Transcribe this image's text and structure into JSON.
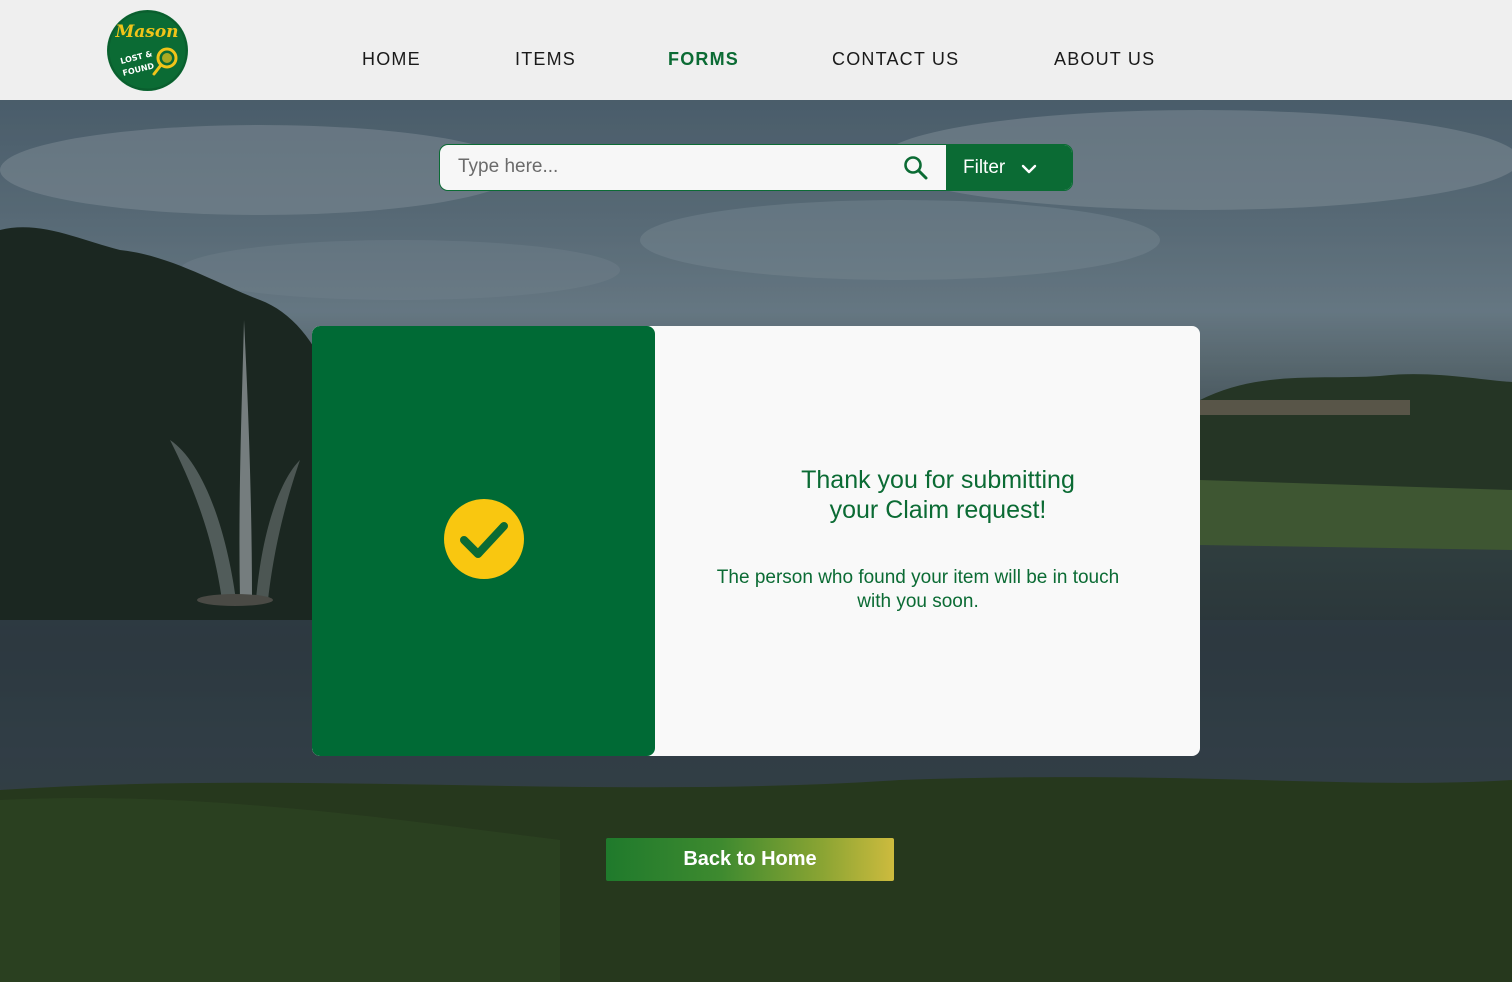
{
  "logo": {
    "top_text": "Mason",
    "bottom_text": "LOST & FOUND"
  },
  "nav": {
    "items": [
      {
        "label": "HOME"
      },
      {
        "label": "ITEMS"
      },
      {
        "label": "FORMS",
        "active": true
      },
      {
        "label": "CONTACT US"
      },
      {
        "label": "ABOUT US"
      }
    ]
  },
  "search": {
    "placeholder": "Type here...",
    "icon": "search-icon",
    "filter_label": "Filter",
    "filter_icon": "chevron-down-icon"
  },
  "confirmation": {
    "icon": "check-circle-icon",
    "title": "Thank you for submitting\nyour Claim request!",
    "message": "The person who found your item will be in touch with you soon."
  },
  "back_button": {
    "label": "Back to Home"
  },
  "colors": {
    "brand_green": "#0b6b34",
    "accent_yellow": "#f9c710",
    "header_bg": "#efefef"
  }
}
